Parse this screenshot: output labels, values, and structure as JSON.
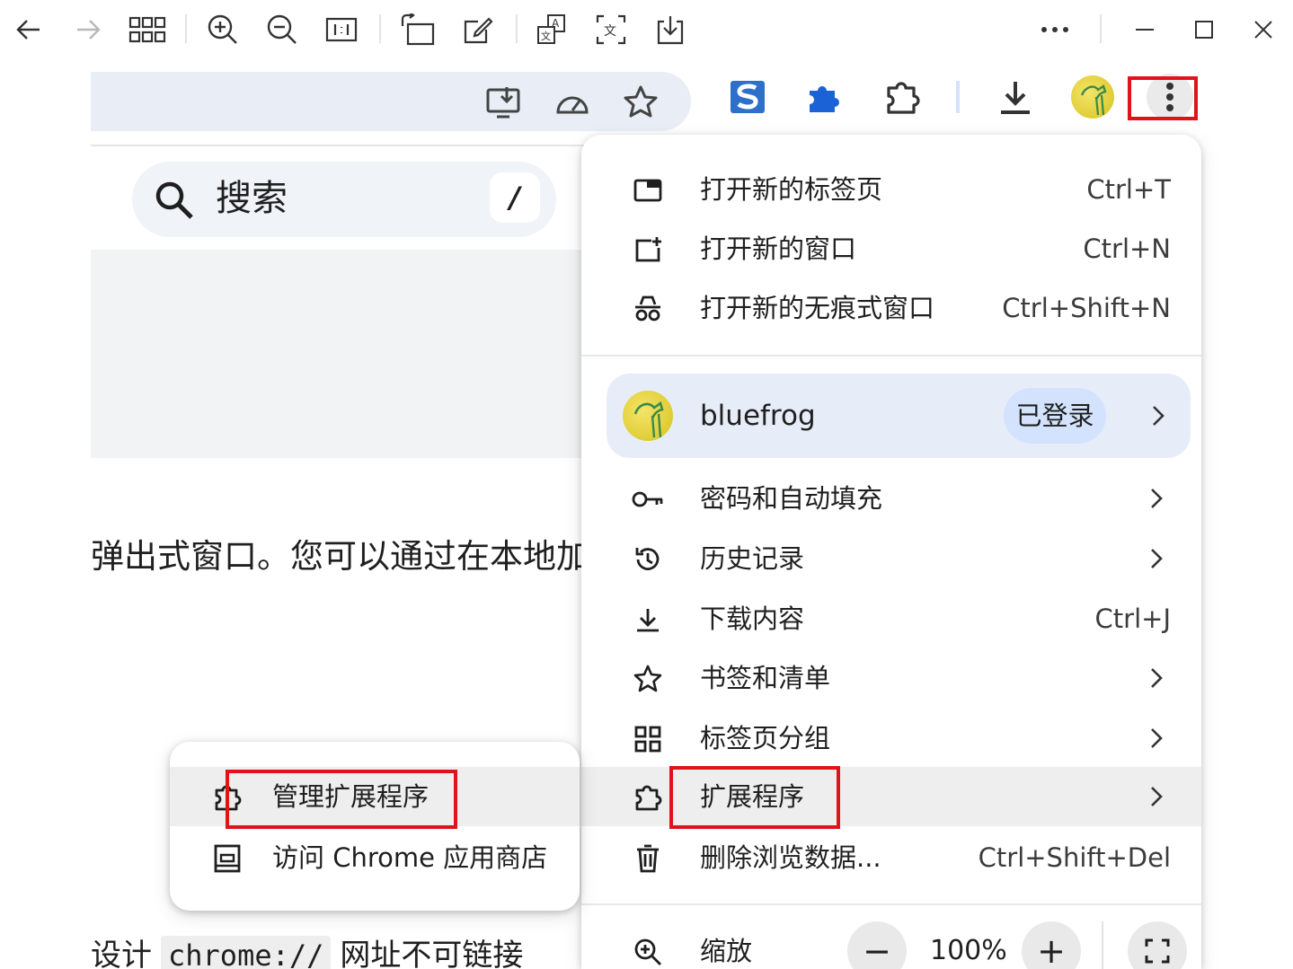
{
  "viewer_toolbar": {
    "icons": [
      "back-arrow-icon",
      "forward-arrow-icon",
      "grid-icon",
      "zoom-in-icon",
      "zoom-out-icon",
      "actual-size-icon",
      "rotate-icon",
      "edit-icon",
      "translate-icon",
      "ocr-icon",
      "save-icon",
      "more-icon",
      "minimize-icon",
      "maximize-icon",
      "close-icon"
    ]
  },
  "browser": {
    "omnibox_icons": [
      "install-app-icon",
      "performance-icon",
      "bookmark-star-icon"
    ],
    "toolbar_icons": [
      "s-extension-icon",
      "blue-puzzle-extension-icon",
      "extensions-icon",
      "download-icon",
      "profile-avatar",
      "kebab-menu-icon"
    ]
  },
  "page": {
    "search_label": "搜索",
    "search_shortcut": "/",
    "body_text": "弹出式窗口。您可以通过在本地加载",
    "bottom_text_before": "设计",
    "bottom_code": "chrome://",
    "bottom_text_after": "网址不可链接"
  },
  "menu": {
    "items_top": [
      {
        "label": "打开新的标签页",
        "shortcut": "Ctrl+T",
        "icon": "new-tab-icon"
      },
      {
        "label": "打开新的窗口",
        "shortcut": "Ctrl+N",
        "icon": "new-window-icon"
      },
      {
        "label": "打开新的无痕式窗口",
        "shortcut": "Ctrl+Shift+N",
        "icon": "incognito-icon"
      }
    ],
    "profile": {
      "name": "bluefrog",
      "status": "已登录"
    },
    "items_mid": [
      {
        "label": "密码和自动填充",
        "shortcut": "",
        "icon": "key-icon"
      },
      {
        "label": "历史记录",
        "shortcut": "",
        "icon": "history-icon"
      },
      {
        "label": "下载内容",
        "shortcut": "Ctrl+J",
        "icon": "download-icon"
      },
      {
        "label": "书签和清单",
        "shortcut": "",
        "icon": "star-icon"
      },
      {
        "label": "标签页分组",
        "shortcut": "",
        "icon": "tab-groups-icon"
      },
      {
        "label": "扩展程序",
        "shortcut": "",
        "icon": "puzzle-icon"
      },
      {
        "label": "删除浏览数据...",
        "shortcut": "Ctrl+Shift+Del",
        "icon": "trash-icon"
      }
    ],
    "zoom": {
      "label": "缩放",
      "minus": "−",
      "value": "100%",
      "plus": "+"
    }
  },
  "submenu": {
    "items": [
      {
        "label": "管理扩展程序",
        "icon": "puzzle-icon"
      },
      {
        "label": "访问 Chrome 应用商店",
        "icon": "web-store-icon"
      }
    ]
  },
  "colors": {
    "highlight_red": "#e0131b",
    "menu_hover": "#eeeeee",
    "profile_bg": "#e7edf8",
    "badge_bg": "#d3e3fd"
  }
}
